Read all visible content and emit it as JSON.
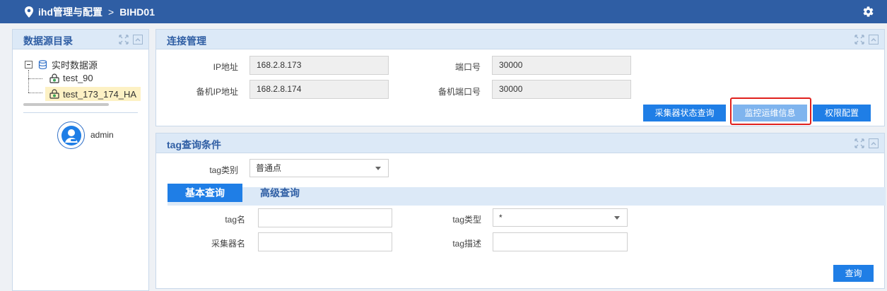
{
  "header": {
    "breadcrumb_root": "ihd管理与配置",
    "separator": ">",
    "breadcrumb_current": "BIHD01",
    "bg_color": "#2f5ea4"
  },
  "sidebar": {
    "title": "数据源目录",
    "tree": {
      "root_label": "实时数据源",
      "items": [
        {
          "label": "test_90",
          "selected": false
        },
        {
          "label": "test_173_174_HA",
          "selected": true
        }
      ]
    },
    "user": {
      "name": "admin"
    }
  },
  "connection": {
    "title": "连接管理",
    "ip_label": "IP地址",
    "ip_value": "168.2.8.173",
    "port_label": "端口号",
    "port_value": "30000",
    "backup_ip_label": "备机IP地址",
    "backup_ip_value": "168.2.8.174",
    "backup_port_label": "备机端口号",
    "backup_port_value": "30000",
    "buttons": {
      "collector_status": "采集器状态查询",
      "monitor_ops": "监控运维信息",
      "permissions": "权限配置"
    }
  },
  "tag_query": {
    "title": "tag查询条件",
    "tag_category_label": "tag类别",
    "tag_category_value": "普通点",
    "tabs": {
      "basic": "基本查询",
      "advanced": "高级查询"
    },
    "tag_name_label": "tag名",
    "tag_name_value": "",
    "tag_type_label": "tag类型",
    "tag_type_value": "*",
    "collector_name_label": "采集器名",
    "collector_name_value": "",
    "tag_desc_label": "tag描述",
    "tag_desc_value": "",
    "query_button": "查询"
  },
  "colors": {
    "accent": "#1f7ee6",
    "panel_header": "#dce9f7",
    "highlight_box": "#e0201d"
  }
}
